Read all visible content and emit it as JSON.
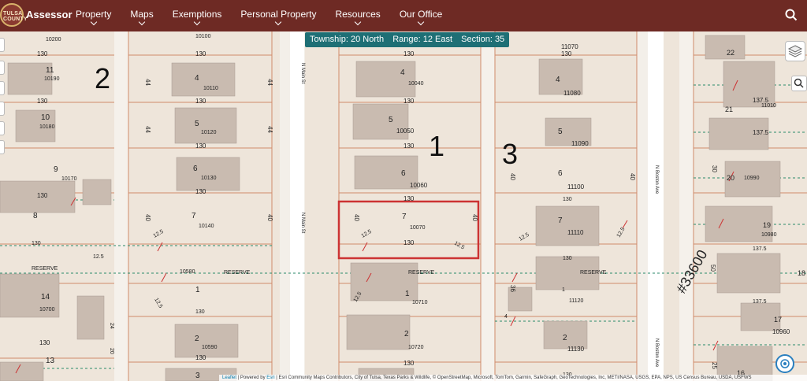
{
  "header": {
    "logo_text": "TULSA COUNTY",
    "brand": "Assessor",
    "nav": [
      "Property",
      "Maps",
      "Exemptions",
      "Personal Property",
      "Resources",
      "Our Office"
    ],
    "search_icon": "search-icon"
  },
  "banner": {
    "township": "Township: 20 North",
    "range": "Range: 12 East",
    "section": "Section: 35"
  },
  "map": {
    "block_labels": [
      "2",
      "1",
      "3"
    ],
    "street_labels": [
      "N Main St",
      "N Main St",
      "N Boston Ave",
      "N Boston Ave"
    ],
    "reserve_label": "RESERVE",
    "annotation": "#33600",
    "lots": {
      "col_a": [
        "10200",
        "11",
        "10190",
        "10",
        "10180",
        "9",
        "10170",
        "8",
        "14",
        "10700",
        "13"
      ],
      "col_b": [
        "10100",
        "4",
        "10110",
        "5",
        "10120",
        "6",
        "10130",
        "7",
        "10140",
        "10580",
        "1",
        "2",
        "10590",
        "3"
      ],
      "col_c": [
        "4",
        "10040",
        "5",
        "10050",
        "6",
        "10060",
        "7",
        "10070",
        "1",
        "10710",
        "2",
        "10720"
      ],
      "col_d": [
        "11070",
        "4",
        "11080",
        "5",
        "11090",
        "6",
        "11100",
        "7",
        "11110",
        "1",
        "11120",
        "2",
        "11130"
      ],
      "col_e": [
        "22",
        "21",
        "11010",
        "20",
        "10990",
        "19",
        "10980",
        "18",
        "17",
        "10960",
        "16"
      ]
    },
    "dims": [
      "130",
      "44",
      "40",
      "12.5",
      "137.5",
      "36",
      "30",
      "50",
      "25",
      "24",
      "20",
      "4"
    ],
    "highlight_color": "#cc3333",
    "parcel_line_color": "#d08a6a",
    "dashed_line_color": "#2a8a6a"
  },
  "attribution": {
    "leaflet": "Leaflet",
    "powered": "| Powered by",
    "esri": "Esri",
    "text": "| Esri Community Maps Contributors, City of Tulsa, Texas Parks & Wildlife, © OpenStreetMap, Microsoft, TomTom, Garmin, SafeGraph, GeoTechnologies, Inc, METI/NASA, USGS, EPA, NPS, US Census Bureau, USDA, USFWS"
  }
}
